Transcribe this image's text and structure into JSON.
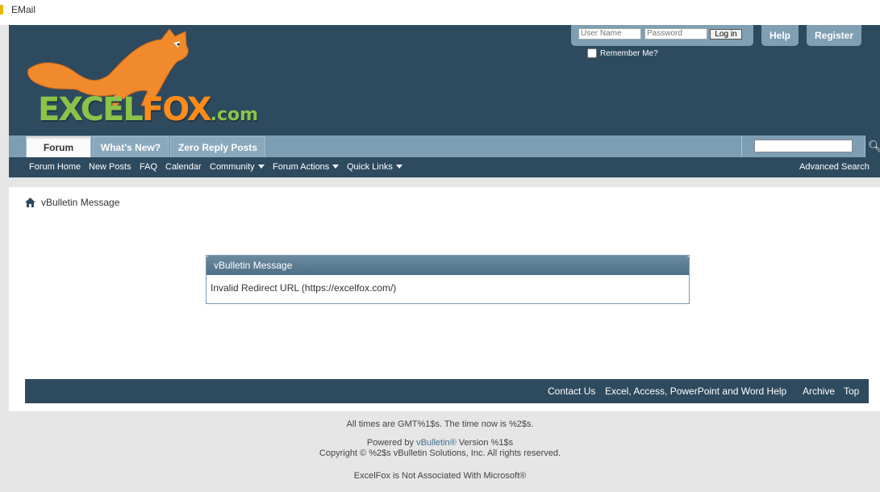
{
  "window": {
    "title": "EMail"
  },
  "logo": {
    "part1": "EXCEL",
    "part2": "FOX",
    "part3": ".com"
  },
  "login": {
    "username_placeholder": "User Name",
    "password_placeholder": "Password",
    "login_button": "Log in",
    "remember_label": "Remember Me?"
  },
  "header_buttons": {
    "help": "Help",
    "register": "Register"
  },
  "tabs": [
    {
      "label": "Forum"
    },
    {
      "label": "What's New?"
    },
    {
      "label": "Zero Reply Posts"
    }
  ],
  "subnav": {
    "forum_home": "Forum Home",
    "new_posts": "New Posts",
    "faq": "FAQ",
    "calendar": "Calendar",
    "community": "Community",
    "forum_actions": "Forum Actions",
    "quick_links": "Quick Links",
    "advanced_search": "Advanced Search"
  },
  "breadcrumb": {
    "label": "vBulletin Message"
  },
  "message": {
    "title": "vBulletin Message",
    "body": "Invalid Redirect URL (https://excelfox.com/)"
  },
  "footer_links": {
    "contact": "Contact Us",
    "help": "Excel, Access, PowerPoint and Word Help",
    "archive": "Archive",
    "top": "Top"
  },
  "bottom": {
    "times": "All times are GMT%1$s. The time now is %2$s.",
    "powered_prefix": "Powered by ",
    "powered_link": "vBulletin®",
    "powered_suffix": " Version %1$s",
    "copyright": "Copyright © %2$s vBulletin Solutions, Inc. All rights reserved.",
    "disclaimer": "ExcelFox is Not Associated With Microsoft®"
  },
  "colors": {
    "header_bg": "#2e4a5f",
    "tab_bar": "#7d9db3",
    "accent_link": "#3f6c8e"
  }
}
